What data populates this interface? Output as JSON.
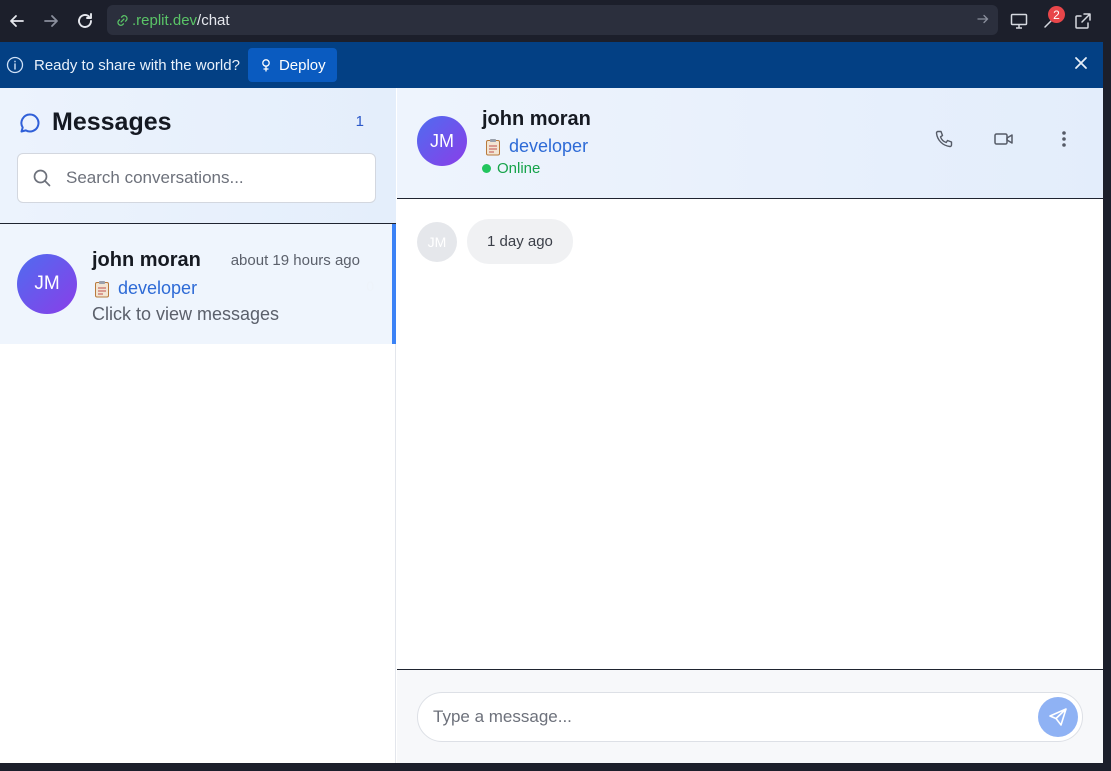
{
  "browser": {
    "url_domain": ".replit.dev",
    "url_path": "/chat",
    "notification_count": "2"
  },
  "banner": {
    "text": "Ready to share with the world?",
    "deploy_label": "Deploy"
  },
  "sidebar": {
    "title": "Messages",
    "count": "1",
    "search_placeholder": "Search conversations..."
  },
  "conversations": [
    {
      "initials": "JM",
      "name": "john moran",
      "time": "about 19 hours ago",
      "role": "developer",
      "preview": "Click to view messages",
      "unread": "0"
    }
  ],
  "chat_header": {
    "initials": "JM",
    "name": "john moran",
    "role": "developer",
    "status": "Online"
  },
  "messages": [
    {
      "initials": "JM",
      "text": "1 day ago"
    }
  ],
  "composer": {
    "placeholder": "Type a message..."
  },
  "colors": {
    "accent": "#3b82f6",
    "banner": "#034084",
    "online": "#22c55e"
  }
}
